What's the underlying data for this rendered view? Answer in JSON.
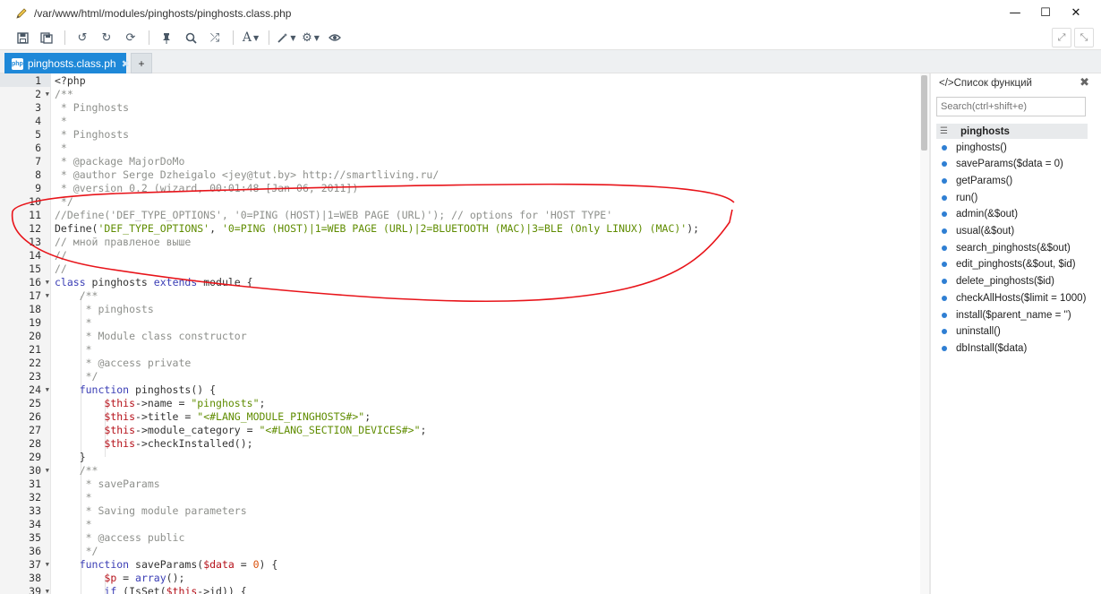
{
  "window": {
    "path": "/var/www/html/modules/pinghosts/pinghosts.class.php",
    "minimize": "—",
    "maximize": "☐",
    "close": "✕"
  },
  "toolbar": {
    "save_icon": "floppy-disk-icon",
    "save_all_icon": "save-all-icon",
    "undo_icon": "undo-icon",
    "redo_icon": "redo-icon",
    "reload_icon": "reload-icon",
    "pin_icon": "pin-icon",
    "search_icon": "search-icon",
    "shuffle_icon": "shuffle-icon",
    "font_label": "A",
    "wand_icon": "magic-wand-icon",
    "settings_icon": "gear-icon",
    "preview_icon": "eye-icon",
    "expand_icon": "expand-icon",
    "fullscreen_icon": "fullscreen-icon"
  },
  "tabs": {
    "active_label": "pinghosts.class.ph",
    "add_label": "+"
  },
  "editor": {
    "lines": [
      {
        "n": "1",
        "fold": false,
        "tokens": [
          [
            "<?php",
            "plain"
          ]
        ]
      },
      {
        "n": "2",
        "fold": true,
        "tokens": [
          [
            "/**",
            "com"
          ]
        ]
      },
      {
        "n": "3",
        "fold": false,
        "tokens": [
          [
            " * Pinghosts",
            "com"
          ]
        ]
      },
      {
        "n": "4",
        "fold": false,
        "tokens": [
          [
            " *",
            "com"
          ]
        ]
      },
      {
        "n": "5",
        "fold": false,
        "tokens": [
          [
            " * Pinghosts",
            "com"
          ]
        ]
      },
      {
        "n": "6",
        "fold": false,
        "tokens": [
          [
            " *",
            "com"
          ]
        ]
      },
      {
        "n": "7",
        "fold": false,
        "tokens": [
          [
            " * @package MajorDoMo",
            "com"
          ]
        ]
      },
      {
        "n": "8",
        "fold": false,
        "tokens": [
          [
            " * @author Serge Dzheigalo <jey@tut.by> http://smartliving.ru/",
            "com"
          ]
        ]
      },
      {
        "n": "9",
        "fold": false,
        "tokens": [
          [
            " * @version 0.2 (wizard, 00:01:48 [Jan 06, 2011])",
            "com"
          ]
        ]
      },
      {
        "n": "10",
        "fold": false,
        "tokens": [
          [
            " */",
            "com"
          ]
        ]
      },
      {
        "n": "11",
        "fold": false,
        "tokens": [
          [
            "//Define('DEF_TYPE_OPTIONS', '0=PING (HOST)|1=WEB PAGE (URL)'); // options for 'HOST TYPE'",
            "com"
          ]
        ]
      },
      {
        "n": "12",
        "fold": false,
        "tokens": [
          [
            "Define(",
            "plain"
          ],
          [
            "'DEF_TYPE_OPTIONS'",
            "str"
          ],
          [
            ", ",
            "plain"
          ],
          [
            "'0=PING (HOST)|1=WEB PAGE (URL)|2=BLUETOOTH (MAC)|3=BLE (Only LINUX) (MAC)'",
            "str"
          ],
          [
            ");",
            "plain"
          ]
        ]
      },
      {
        "n": "13",
        "fold": false,
        "tokens": [
          [
            "// мной правленое выше",
            "com"
          ]
        ]
      },
      {
        "n": "14",
        "fold": false,
        "tokens": [
          [
            "//",
            "com"
          ]
        ]
      },
      {
        "n": "15",
        "fold": false,
        "tokens": [
          [
            "//",
            "com"
          ]
        ]
      },
      {
        "n": "16",
        "fold": true,
        "tokens": [
          [
            "class",
            "kw"
          ],
          [
            " pinghosts ",
            "plain"
          ],
          [
            "extends",
            "kw"
          ],
          [
            " module {",
            "plain"
          ]
        ]
      },
      {
        "n": "17",
        "fold": true,
        "tokens": [
          [
            "    /**",
            "com"
          ]
        ]
      },
      {
        "n": "18",
        "fold": false,
        "tokens": [
          [
            "     * pinghosts",
            "com"
          ]
        ]
      },
      {
        "n": "19",
        "fold": false,
        "tokens": [
          [
            "     *",
            "com"
          ]
        ]
      },
      {
        "n": "20",
        "fold": false,
        "tokens": [
          [
            "     * Module class constructor",
            "com"
          ]
        ]
      },
      {
        "n": "21",
        "fold": false,
        "tokens": [
          [
            "     *",
            "com"
          ]
        ]
      },
      {
        "n": "22",
        "fold": false,
        "tokens": [
          [
            "     * @access private",
            "com"
          ]
        ]
      },
      {
        "n": "23",
        "fold": false,
        "tokens": [
          [
            "     */",
            "com"
          ]
        ]
      },
      {
        "n": "24",
        "fold": true,
        "tokens": [
          [
            "    ",
            "plain"
          ],
          [
            "function",
            "kw"
          ],
          [
            " pinghosts() {",
            "plain"
          ]
        ]
      },
      {
        "n": "25",
        "fold": false,
        "tokens": [
          [
            "        ",
            "plain"
          ],
          [
            "$this",
            "var"
          ],
          [
            "->name = ",
            "plain"
          ],
          [
            "\"pinghosts\"",
            "str"
          ],
          [
            ";",
            "plain"
          ]
        ]
      },
      {
        "n": "26",
        "fold": false,
        "tokens": [
          [
            "        ",
            "plain"
          ],
          [
            "$this",
            "var"
          ],
          [
            "->title = ",
            "plain"
          ],
          [
            "\"<#LANG_MODULE_PINGHOSTS#>\"",
            "str"
          ],
          [
            ";",
            "plain"
          ]
        ]
      },
      {
        "n": "27",
        "fold": false,
        "tokens": [
          [
            "        ",
            "plain"
          ],
          [
            "$this",
            "var"
          ],
          [
            "->module_category = ",
            "plain"
          ],
          [
            "\"<#LANG_SECTION_DEVICES#>\"",
            "str"
          ],
          [
            ";",
            "plain"
          ]
        ]
      },
      {
        "n": "28",
        "fold": false,
        "tokens": [
          [
            "        ",
            "plain"
          ],
          [
            "$this",
            "var"
          ],
          [
            "->checkInstalled();",
            "plain"
          ]
        ]
      },
      {
        "n": "29",
        "fold": false,
        "tokens": [
          [
            "    }",
            "plain"
          ]
        ]
      },
      {
        "n": "30",
        "fold": true,
        "tokens": [
          [
            "    /**",
            "com"
          ]
        ]
      },
      {
        "n": "31",
        "fold": false,
        "tokens": [
          [
            "     * saveParams",
            "com"
          ]
        ]
      },
      {
        "n": "32",
        "fold": false,
        "tokens": [
          [
            "     *",
            "com"
          ]
        ]
      },
      {
        "n": "33",
        "fold": false,
        "tokens": [
          [
            "     * Saving module parameters",
            "com"
          ]
        ]
      },
      {
        "n": "34",
        "fold": false,
        "tokens": [
          [
            "     *",
            "com"
          ]
        ]
      },
      {
        "n": "35",
        "fold": false,
        "tokens": [
          [
            "     * @access public",
            "com"
          ]
        ]
      },
      {
        "n": "36",
        "fold": false,
        "tokens": [
          [
            "     */",
            "com"
          ]
        ]
      },
      {
        "n": "37",
        "fold": true,
        "tokens": [
          [
            "    ",
            "plain"
          ],
          [
            "function",
            "kw"
          ],
          [
            " saveParams(",
            "plain"
          ],
          [
            "$data",
            "var"
          ],
          [
            " = ",
            "plain"
          ],
          [
            "0",
            "num"
          ],
          [
            ") {",
            "plain"
          ]
        ]
      },
      {
        "n": "38",
        "fold": false,
        "tokens": [
          [
            "        ",
            "plain"
          ],
          [
            "$p",
            "var"
          ],
          [
            " = ",
            "plain"
          ],
          [
            "array",
            "kw"
          ],
          [
            "();",
            "plain"
          ]
        ]
      },
      {
        "n": "39",
        "fold": true,
        "tokens": [
          [
            "        ",
            "plain"
          ],
          [
            "if",
            "kw"
          ],
          [
            " (IsSet(",
            "plain"
          ],
          [
            "$this",
            "var"
          ],
          [
            "->id)) {",
            "plain"
          ]
        ]
      }
    ]
  },
  "functions_panel": {
    "title": "</>Список функций",
    "close": "✖",
    "search_placeholder": "Search(ctrl+shift+e)",
    "root": "pinghosts",
    "items": [
      "pinghosts()",
      "saveParams($data = 0)",
      "getParams()",
      "run()",
      "admin(&$out)",
      "usual(&$out)",
      "search_pinghosts(&$out)",
      "edit_pinghosts(&$out, $id)",
      "delete_pinghosts($id)",
      "checkAllHosts($limit = 1000)",
      "install($parent_name = '')",
      "uninstall()",
      "dbInstall($data)"
    ]
  },
  "colors": {
    "accent": "#1e88d8",
    "annotation": "#e8141a"
  }
}
